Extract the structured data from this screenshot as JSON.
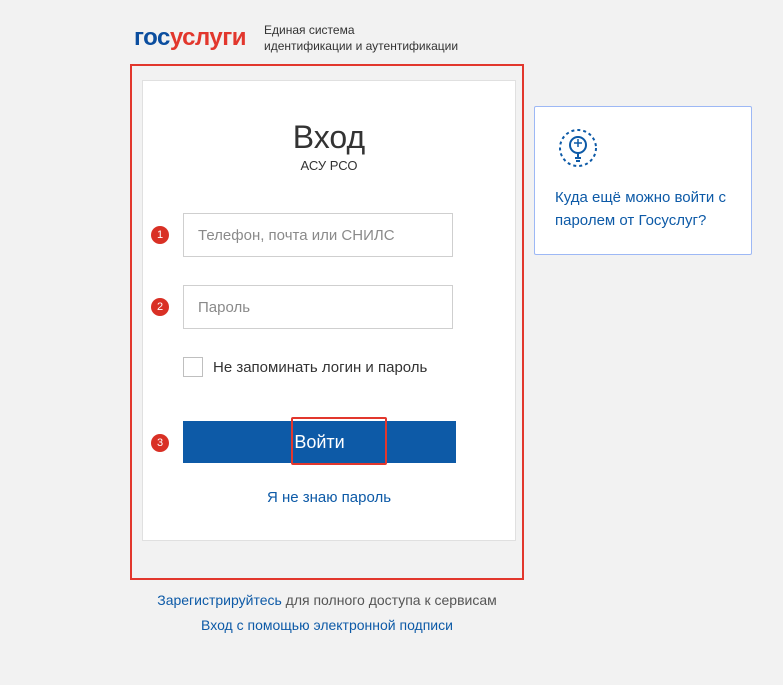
{
  "header": {
    "logo_part1": "гос",
    "logo_part2": "услуги",
    "tagline_line1": "Единая система",
    "tagline_line2": "идентификации и аутентификации"
  },
  "login": {
    "title": "Вход",
    "subtitle": "АСУ РСО",
    "login_placeholder": "Телефон, почта или СНИЛС",
    "password_placeholder": "Пароль",
    "remember_label": "Не запоминать логин и пароль",
    "submit_label": "Войти",
    "forgot_label": "Я не знаю пароль"
  },
  "steps": {
    "one": "1",
    "two": "2",
    "three": "3"
  },
  "bottom": {
    "register_link": "Зарегистрируйтесь",
    "register_rest": " для полного доступа к сервисам",
    "esign_link": "Вход с помощью электронной подписи"
  },
  "side": {
    "link_text": "Куда ещё можно войти с паролем от Госуслуг?"
  }
}
